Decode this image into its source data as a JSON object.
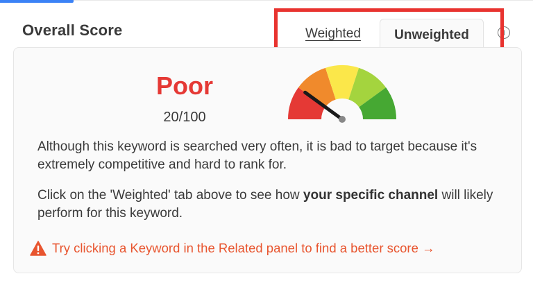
{
  "header": {
    "title": "Overall Score"
  },
  "tabs": {
    "weighted_label": "Weighted",
    "unweighted_label": "Unweighted",
    "active": "Unweighted",
    "info_glyph": "i"
  },
  "score": {
    "label": "Poor",
    "value_text": "20/100",
    "value": 20,
    "max": 100,
    "label_color": "#e53935"
  },
  "gauge": {
    "segment_colors": [
      "#e53935",
      "#f08a2c",
      "#fbe74a",
      "#a4d43e",
      "#46a833"
    ],
    "needle_color": "#1a1a1a",
    "hub_color": "#888888"
  },
  "description": {
    "line1": "Although this keyword is searched very often, it is bad to target because it's extremely competitive and hard to rank for.",
    "line2_part1": "Click on the 'Weighted' tab above to see how ",
    "line2_bold1": "your specific channel",
    "line2_part2": " will likely perform for this keyword."
  },
  "tip": {
    "text": "Try clicking a Keyword in the Related panel to find a better score →",
    "color": "#e8552f"
  },
  "highlight": {
    "color": "#e8332f"
  }
}
